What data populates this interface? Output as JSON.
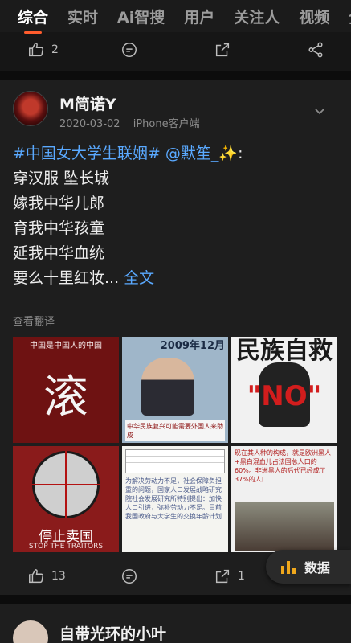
{
  "tabs": [
    "综合",
    "实时",
    "Ai智搜",
    "用户",
    "关注人",
    "视频",
    "全"
  ],
  "prev_actions": {
    "like_count": "2"
  },
  "post": {
    "username": "M简诺Y",
    "date": "2020-03-02",
    "source": "iPhone客户端",
    "hashtag": "#中国女大学生联姻#",
    "mention": "@默笙_",
    "emoji": "✨:",
    "lines": [
      "穿汉服 坠长城",
      "嫁我中华儿郎",
      "育我中华孩童",
      "延我中华血统"
    ],
    "last_line": "要么十里红妆...",
    "full_text": "全文",
    "translate": "查看翻译",
    "images": {
      "img1": {
        "top": "中国是中国人的中国",
        "big": "滚"
      },
      "img2": {
        "top": "2009年12月",
        "caption": "中华民族复兴可能需要外国人来助成"
      },
      "img3": {
        "top": "民族自救",
        "big": "\"NO\""
      },
      "img4": {
        "big": "停止卖国",
        "sub": "STOP THE TRAITORS"
      },
      "img5": {
        "text": "为解决劳动力不足，社会保障负担重的问题，国家人口发展战略研究院社会发展研究所特别提出：加快人口引进，弥补劳动力不足。目前我国政府与大学生的交换年龄计划"
      },
      "img6": {
        "text": "现在其人种的构成，就是欧洲黑人+黑白混血儿占法国总人口的60%。非洲黑人的后代已经成了37%的人口"
      }
    },
    "like_count": "13",
    "share_count": "1"
  },
  "fab": {
    "label": "数据"
  },
  "next_post": {
    "username": "自带光环的小叶"
  }
}
